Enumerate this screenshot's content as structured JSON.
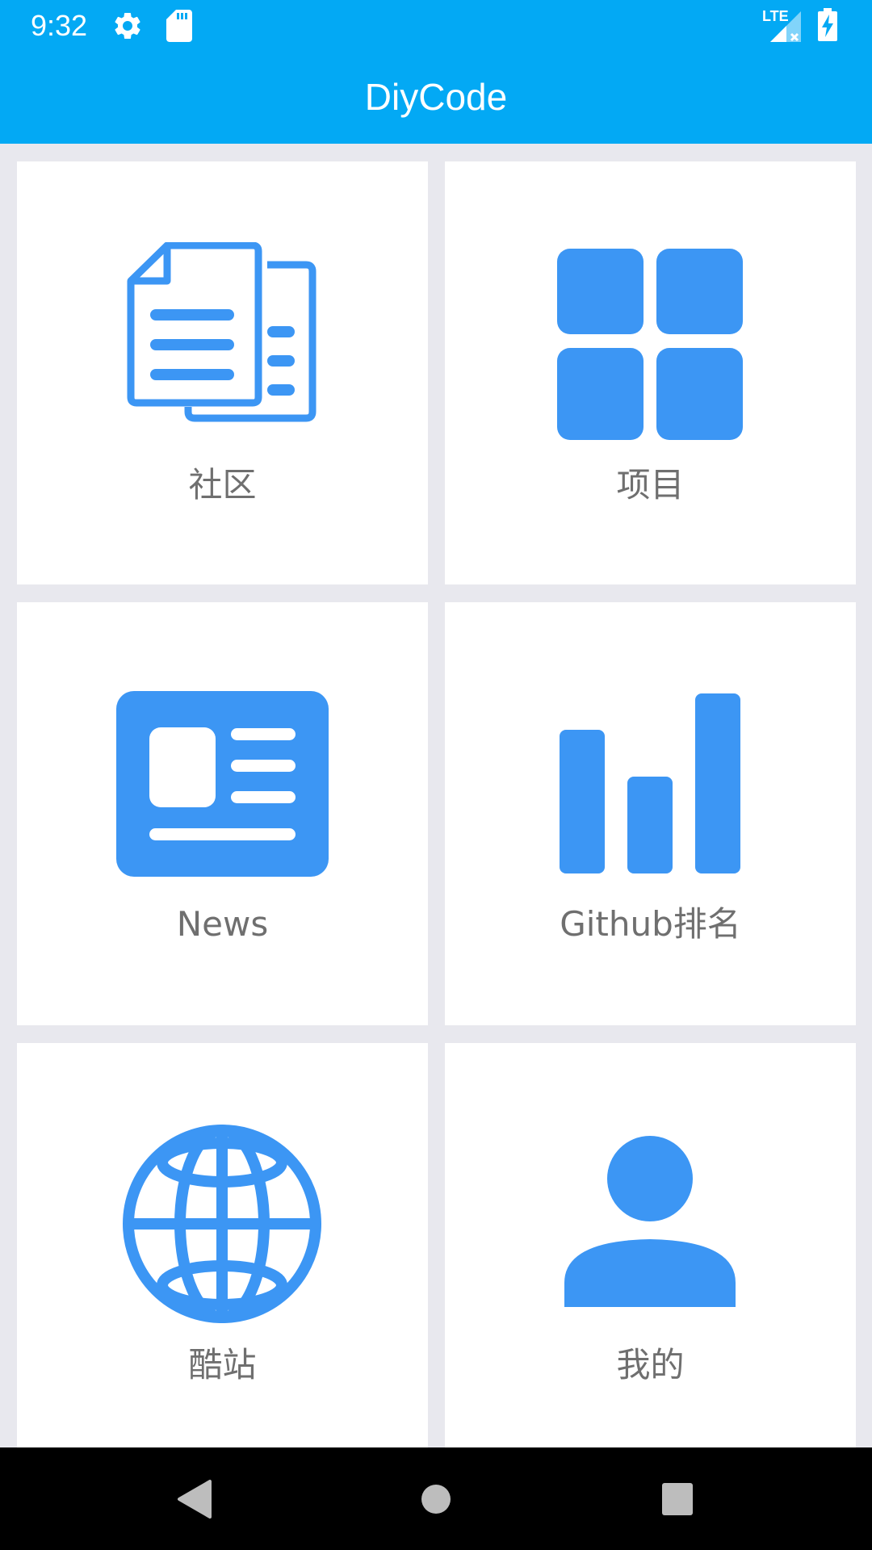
{
  "status_bar": {
    "time": "9:32",
    "network_label": "LTE",
    "icons": [
      "settings-gear-icon",
      "sd-card-icon",
      "signal-lte-no-service-icon",
      "battery-charging-icon"
    ]
  },
  "app_bar": {
    "title": "DiyCode"
  },
  "tiles": [
    {
      "label": "社区",
      "icon": "documents-icon"
    },
    {
      "label": "项目",
      "icon": "grid-apps-icon"
    },
    {
      "label": "News",
      "icon": "newspaper-icon"
    },
    {
      "label": "Github排名",
      "icon": "bar-chart-icon"
    },
    {
      "label": "酷站",
      "icon": "globe-icon"
    },
    {
      "label": "我的",
      "icon": "person-icon"
    }
  ],
  "nav_bar": {
    "icons": [
      "back-triangle-icon",
      "home-circle-icon",
      "recents-square-icon"
    ]
  },
  "colors": {
    "app_bar": "#03a9f4",
    "icon_blue": "#3c96f4",
    "tile_bg": "#ffffff",
    "grid_bg": "#e8e8ee",
    "label_gray": "#6f6f6f",
    "nav_bg": "#000000"
  }
}
